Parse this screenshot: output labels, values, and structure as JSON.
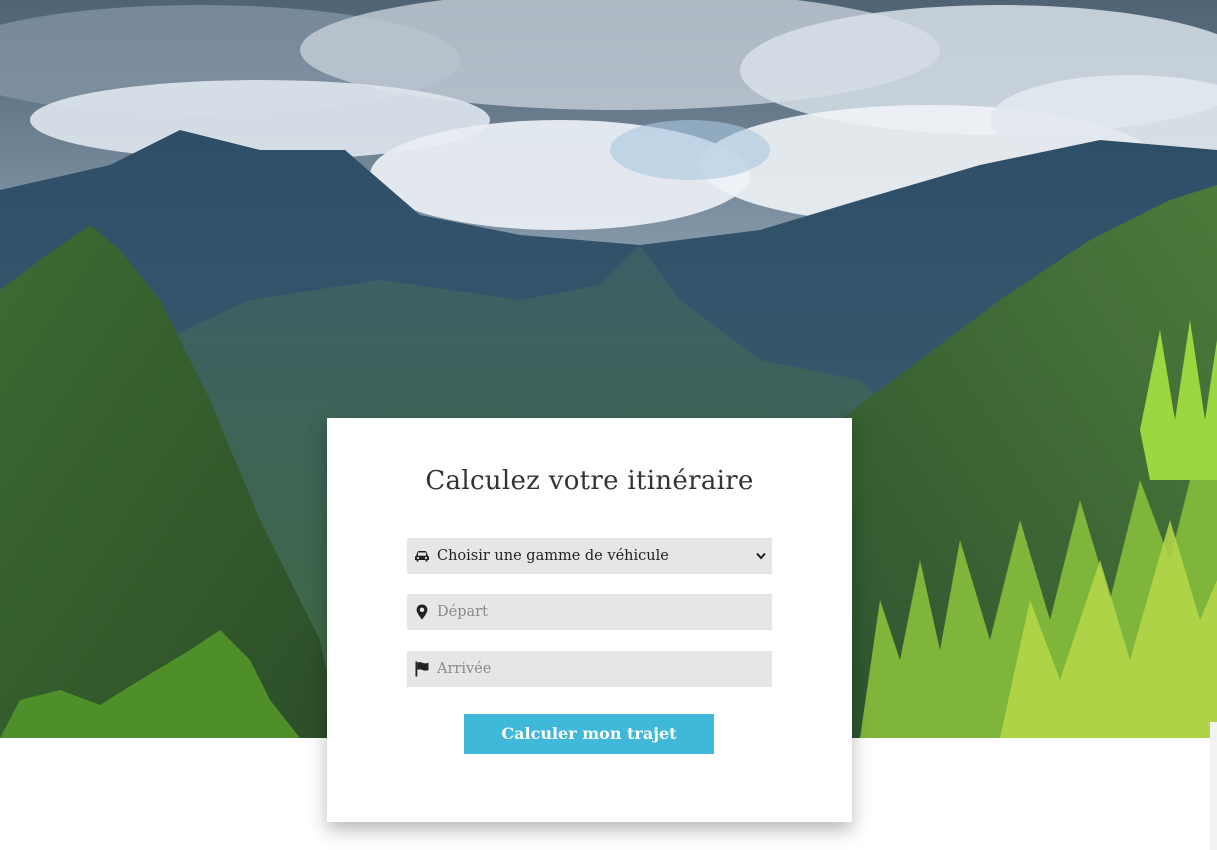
{
  "form": {
    "title": "Calculez votre itinéraire",
    "vehicle_select": {
      "value": "Choisir une gamme de véhicule",
      "icon": "car-icon"
    },
    "departure": {
      "placeholder": "Départ",
      "icon": "map-marker-icon"
    },
    "arrival": {
      "placeholder": "Arrivée",
      "icon": "flag-icon"
    },
    "submit_label": "Calculer mon trajet"
  },
  "colors": {
    "button": "#40b8d9",
    "field_background": "#e6e6e6",
    "title_text": "#333333"
  }
}
